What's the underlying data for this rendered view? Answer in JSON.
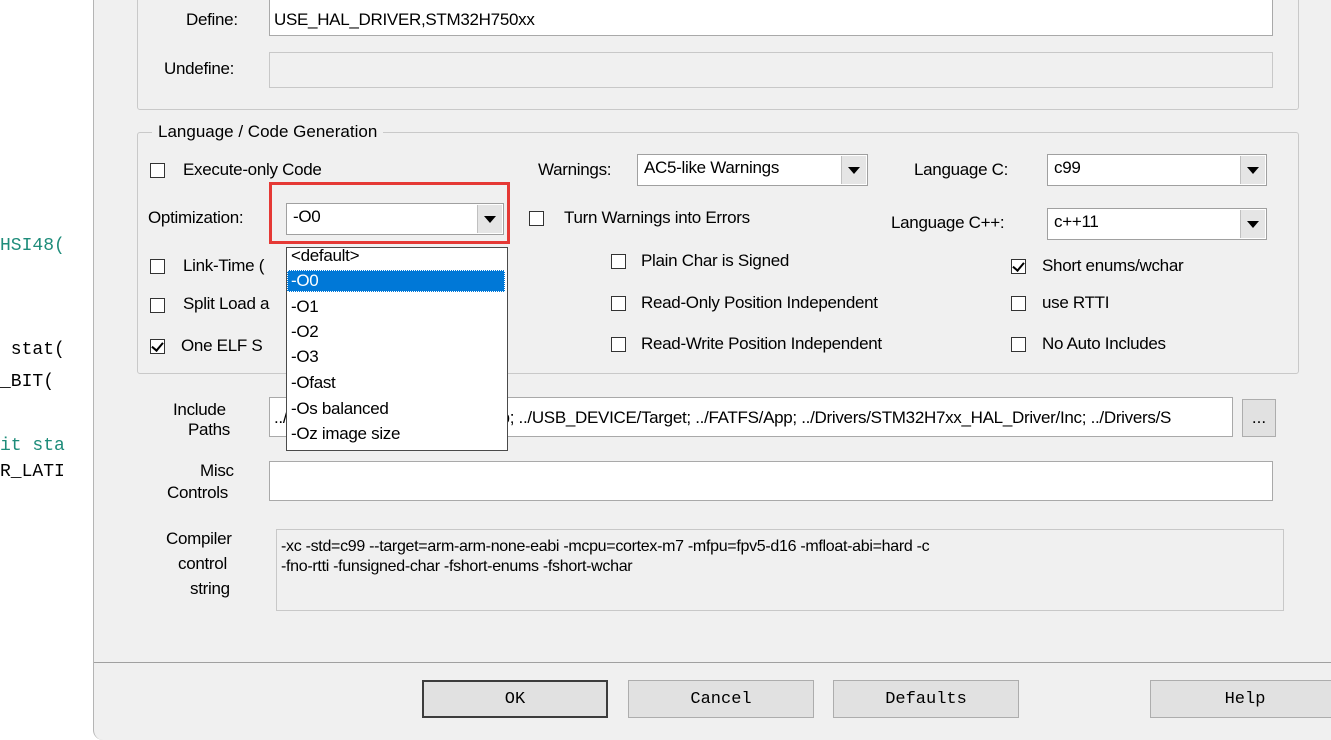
{
  "background_code": {
    "line1": "HSI48(",
    "line2": " stat(",
    "line3": "_BIT(",
    "line4": "it sta",
    "line5": "R_LATI"
  },
  "preprocessor": {
    "define_label": "Define:",
    "define_value": "USE_HAL_DRIVER,STM32H750xx",
    "undefine_label": "Undefine:",
    "undefine_value": ""
  },
  "language_group": {
    "title": "Language / Code Generation",
    "execute_only": {
      "label": "Execute-only Code",
      "checked": false
    },
    "warnings_label": "Warnings:",
    "warnings_value": "AC5-like Warnings",
    "language_c_label": "Language C:",
    "language_c_value": "c99",
    "optimization_label": "Optimization:",
    "optimization_value": "-O0",
    "turn_warnings": {
      "label": "Turn Warnings into Errors",
      "checked": false
    },
    "language_cpp_label": "Language C++:",
    "language_cpp_value": "c++11",
    "link_time": {
      "label": "Link-Time (",
      "checked": false
    },
    "plain_char": {
      "label": "Plain Char is Signed",
      "checked": false
    },
    "short_enums": {
      "label": "Short enums/wchar",
      "checked": true
    },
    "split_load": {
      "label": "Split Load a",
      "checked": false
    },
    "ro_pi": {
      "label": "Read-Only Position Independent",
      "checked": false
    },
    "use_rtti": {
      "label": "use RTTI",
      "checked": false
    },
    "one_elf": {
      "label": "One ELF S",
      "checked": true
    },
    "rw_pi": {
      "label": "Read-Write Position Independent",
      "checked": false
    },
    "no_auto_includes": {
      "label": "No Auto Includes",
      "checked": false
    }
  },
  "optimization_dropdown": {
    "options": [
      "<default>",
      "-O0",
      "-O1",
      "-O2",
      "-O3",
      "-Ofast",
      "-Os balanced",
      "-Oz image size"
    ],
    "selected_index": 1
  },
  "paths": {
    "include_label_1": "Include",
    "include_label_2": "Paths",
    "include_value": "../Core/Inc; ../USB_DEVICE/App; ../USB_DEVICE/Target; ../FATFS/App; ../Drivers/STM32H7xx_HAL_Driver/Inc; ../Drivers/S",
    "browse_label": "...",
    "misc_label_1": "Misc",
    "misc_label_2": "Controls",
    "misc_value": ""
  },
  "compiler_control": {
    "label_1": "Compiler",
    "label_2": "control",
    "label_3": "string",
    "line1": "-xc -std=c99 --target=arm-arm-none-eabi -mcpu=cortex-m7 -mfpu=fpv5-d16 -mfloat-abi=hard -c",
    "line2": "-fno-rtti -funsigned-char -fshort-enums -fshort-wchar"
  },
  "buttons": {
    "ok": "OK",
    "cancel": "Cancel",
    "defaults": "Defaults",
    "help": "Help"
  },
  "colors": {
    "highlight": "#0078d7",
    "annotation_box": "#e53935",
    "dialog_bg": "#f0f0f0"
  }
}
